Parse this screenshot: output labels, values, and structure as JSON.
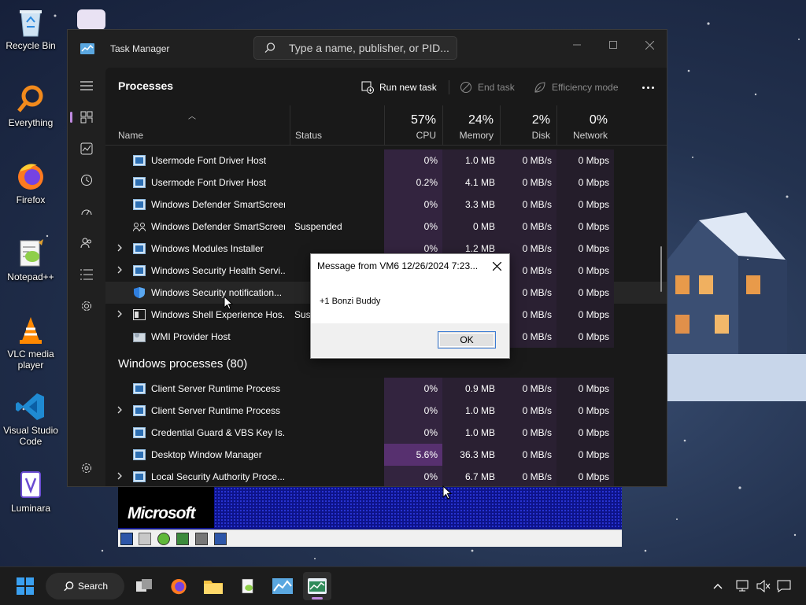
{
  "desktop": {
    "icons": [
      {
        "label": "Recycle Bin"
      },
      {
        "label": "Everything"
      },
      {
        "label": "Firefox"
      },
      {
        "label": "Notepad++"
      },
      {
        "label": "VLC media player"
      },
      {
        "label": "Visual Studio Code"
      },
      {
        "label": "Luminara"
      }
    ]
  },
  "task_manager": {
    "title": "Task Manager",
    "search_placeholder": "Type a name, publisher, or PID...",
    "page_title": "Processes",
    "toolbar": {
      "run_new_task": "Run new task",
      "end_task": "End task",
      "efficiency_mode": "Efficiency mode"
    },
    "columns": {
      "name": "Name",
      "status": "Status",
      "cpu": {
        "pct": "57%",
        "label": "CPU"
      },
      "memory": {
        "pct": "24%",
        "label": "Memory"
      },
      "disk": {
        "pct": "2%",
        "label": "Disk"
      },
      "network": {
        "pct": "0%",
        "label": "Network"
      }
    },
    "rows": [
      {
        "name": "Usermode Font Driver Host",
        "status": "",
        "cpu": "0%",
        "memory": "1.0 MB",
        "disk": "0 MB/s",
        "network": "0 Mbps"
      },
      {
        "name": "Usermode Font Driver Host",
        "status": "",
        "cpu": "0.2%",
        "memory": "4.1 MB",
        "disk": "0 MB/s",
        "network": "0 Mbps"
      },
      {
        "name": "Windows Defender SmartScreen",
        "status": "",
        "cpu": "0%",
        "memory": "3.3 MB",
        "disk": "0 MB/s",
        "network": "0 Mbps"
      },
      {
        "name": "Windows Defender SmartScreen",
        "status": "Suspended",
        "cpu": "0%",
        "memory": "0 MB",
        "disk": "0 MB/s",
        "network": "0 Mbps"
      },
      {
        "name": "Windows Modules Installer",
        "status": "",
        "cpu": "0%",
        "memory": "1.2 MB",
        "disk": "0 MB/s",
        "network": "0 Mbps"
      },
      {
        "name": "Windows Security Health Servi...",
        "status": "",
        "cpu": "",
        "memory": "",
        "disk": "0 MB/s",
        "network": "0 Mbps"
      },
      {
        "name": "Windows Security notification...",
        "status": "",
        "cpu": "",
        "memory": "",
        "disk": "0 MB/s",
        "network": "0 Mbps"
      },
      {
        "name": "Windows Shell Experience Hos...",
        "status": "Sus",
        "cpu": "",
        "memory": "",
        "disk": "0 MB/s",
        "network": "0 Mbps"
      },
      {
        "name": "WMI Provider Host",
        "status": "",
        "cpu": "",
        "memory": "",
        "disk": "0 MB/s",
        "network": "0 Mbps"
      }
    ],
    "group_label": "Windows processes (80)",
    "rows2": [
      {
        "name": "Client Server Runtime Process",
        "status": "",
        "cpu": "0%",
        "memory": "0.9 MB",
        "disk": "0 MB/s",
        "network": "0 Mbps"
      },
      {
        "name": "Client Server Runtime Process",
        "status": "",
        "cpu": "0%",
        "memory": "1.0 MB",
        "disk": "0 MB/s",
        "network": "0 Mbps"
      },
      {
        "name": "Credential Guard & VBS Key Is...",
        "status": "",
        "cpu": "0%",
        "memory": "1.0 MB",
        "disk": "0 MB/s",
        "network": "0 Mbps"
      },
      {
        "name": "Desktop Window Manager",
        "status": "",
        "cpu": "5.6%",
        "memory": "36.3 MB",
        "disk": "0 MB/s",
        "network": "0 Mbps"
      },
      {
        "name": "Local Security Authority Proce...",
        "status": "",
        "cpu": "0%",
        "memory": "6.7 MB",
        "disk": "0 MB/s",
        "network": "0 Mbps"
      }
    ]
  },
  "dialog": {
    "title": "Message from VM6 12/26/2024 7:23...",
    "message": "+1 Bonzi Buddy",
    "ok": "OK"
  },
  "vm_window": {
    "logo": "Microsoft"
  },
  "taskbar": {
    "search_label": "Search"
  },
  "colors": {
    "accent": "#c08ae0",
    "cpu_hot": "#57306f",
    "window_bg": "#202020"
  }
}
